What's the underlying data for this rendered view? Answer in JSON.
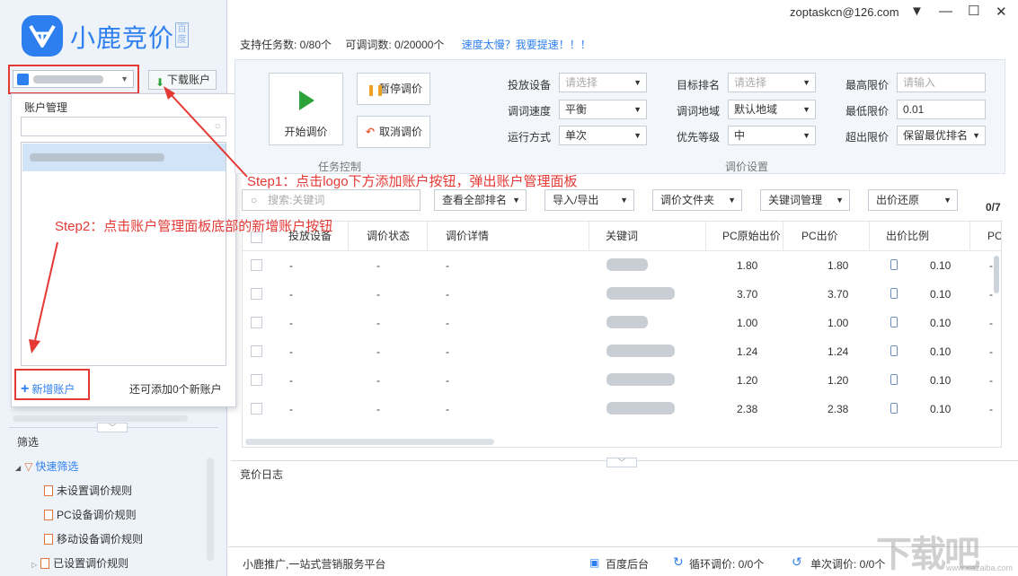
{
  "brand": {
    "name": "小鹿竞价",
    "badge": "百度"
  },
  "window": {
    "account_email": "zoptaskcn@126.com",
    "menu_icon": "dropdown-icon",
    "minimize_icon": "minimize-icon",
    "maximize_icon": "maximize-icon",
    "close_icon": "close-icon"
  },
  "sidebar": {
    "download_label": "下载账户",
    "account_popup": {
      "title": "账户管理",
      "add_label": "新增账户",
      "remaining_text": "还可添加0个新账户"
    },
    "filter_title": "筛选",
    "quick_filter_label": "快速筛选",
    "rules": [
      "未设置调价规则",
      "PC设备调价规则",
      "移动设备调价规则",
      "已设置调价规则"
    ]
  },
  "stats": {
    "tasks_label": "支持任务数: 0/80个",
    "keywords_label": "可调词数: 0/20000个",
    "speed_link": "速度太慢？我要提速！！！"
  },
  "control": {
    "start_label": "开始调价",
    "pause_label": "暂停调价",
    "cancel_label": "取消调价",
    "section_task": "任务控制",
    "section_settings": "调价设置",
    "fields": {
      "device": {
        "label": "投放设备",
        "value": "请选择"
      },
      "speed": {
        "label": "调词速度",
        "value": "平衡"
      },
      "mode": {
        "label": "运行方式",
        "value": "单次"
      },
      "target_rank": {
        "label": "目标排名",
        "value": "请选择"
      },
      "region": {
        "label": "调词地域",
        "value": "默认地域"
      },
      "priority": {
        "label": "优先等级",
        "value": "中"
      },
      "max_price": {
        "label": "最高限价",
        "placeholder": "请输入"
      },
      "min_price": {
        "label": "最低限价",
        "value": "0.01"
      },
      "over_limit": {
        "label": "超出限价",
        "value": "保留最优排名"
      }
    }
  },
  "annotations": {
    "step1": "Step1：点击logo下方添加账户按钮，弹出账户管理面板",
    "step2": "Step2：点击账户管理面板底部的新增账户按钮"
  },
  "toolbar": {
    "search_placeholder": "搜索:关键词",
    "view_rank": "查看全部排名",
    "import_export": "导入/导出",
    "price_folder": "调价文件夹",
    "keyword_mgmt": "关键词管理",
    "restore_price": "出价还原",
    "count": "0/7"
  },
  "table": {
    "headers": [
      "投放设备",
      "调价状态",
      "调价详情",
      "关键词",
      "PC原始出价",
      "PC出价",
      "出价比例",
      "PC"
    ],
    "rows": [
      {
        "device": "-",
        "status": "-",
        "detail": "-",
        "orig": "1.80",
        "pc": "1.80",
        "ratio": "0.10",
        "tail": "-"
      },
      {
        "device": "-",
        "status": "-",
        "detail": "-",
        "orig": "3.70",
        "pc": "3.70",
        "ratio": "0.10",
        "tail": "-"
      },
      {
        "device": "-",
        "status": "-",
        "detail": "-",
        "orig": "1.00",
        "pc": "1.00",
        "ratio": "0.10",
        "tail": "-"
      },
      {
        "device": "-",
        "status": "-",
        "detail": "-",
        "orig": "1.24",
        "pc": "1.24",
        "ratio": "0.10",
        "tail": "-"
      },
      {
        "device": "-",
        "status": "-",
        "detail": "-",
        "orig": "1.20",
        "pc": "1.20",
        "ratio": "0.10",
        "tail": "-"
      },
      {
        "device": "-",
        "status": "-",
        "detail": "-",
        "orig": "2.38",
        "pc": "2.38",
        "ratio": "0.10",
        "tail": "-"
      }
    ]
  },
  "log": {
    "title": "竞价日志"
  },
  "statusbar": {
    "slogan": "小鹿推广,一站式营销服务平台",
    "baidu_backend": "百度后台",
    "loop_label": "循环调价: 0/0个",
    "single_label": "单次调价: 0/0个"
  },
  "watermark": {
    "text": "下载吧",
    "url": "www.xiazaiba.com"
  },
  "colors": {
    "accent": "#2d7ff0",
    "annotation_red": "#e53935",
    "play_green": "#2aa33b"
  }
}
